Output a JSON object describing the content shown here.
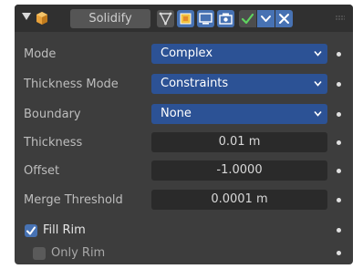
{
  "header": {
    "modifier_name": "Solidify",
    "icons": [
      "wrench-icon",
      "edit-mode-icon",
      "on-cage-icon",
      "viewport-icon",
      "render-icon",
      "apply-check-icon",
      "chevron-down-icon",
      "close-icon",
      "drag-grip-icon"
    ]
  },
  "fields": {
    "mode": {
      "label": "Mode",
      "value": "Complex"
    },
    "thickness_mode": {
      "label": "Thickness Mode",
      "value": "Constraints"
    },
    "boundary": {
      "label": "Boundary",
      "value": "None"
    },
    "thickness": {
      "label": "Thickness",
      "value": "0.01 m"
    },
    "offset": {
      "label": "Offset",
      "value": "-1.0000"
    },
    "merge_threshold": {
      "label": "Merge Threshold",
      "value": "0.0001 m"
    }
  },
  "options": {
    "fill_rim": {
      "label": "Fill Rim",
      "checked": true
    },
    "only_rim": {
      "label": "Only Rim",
      "checked": false
    }
  },
  "colors": {
    "panel_bg": "#3d3d3d",
    "header_bg": "#303030",
    "accent_blue": "#4772b3",
    "dropdown_blue": "#2c5295",
    "field_bg": "#2a2a2a",
    "check_green": "#5fd35f"
  }
}
